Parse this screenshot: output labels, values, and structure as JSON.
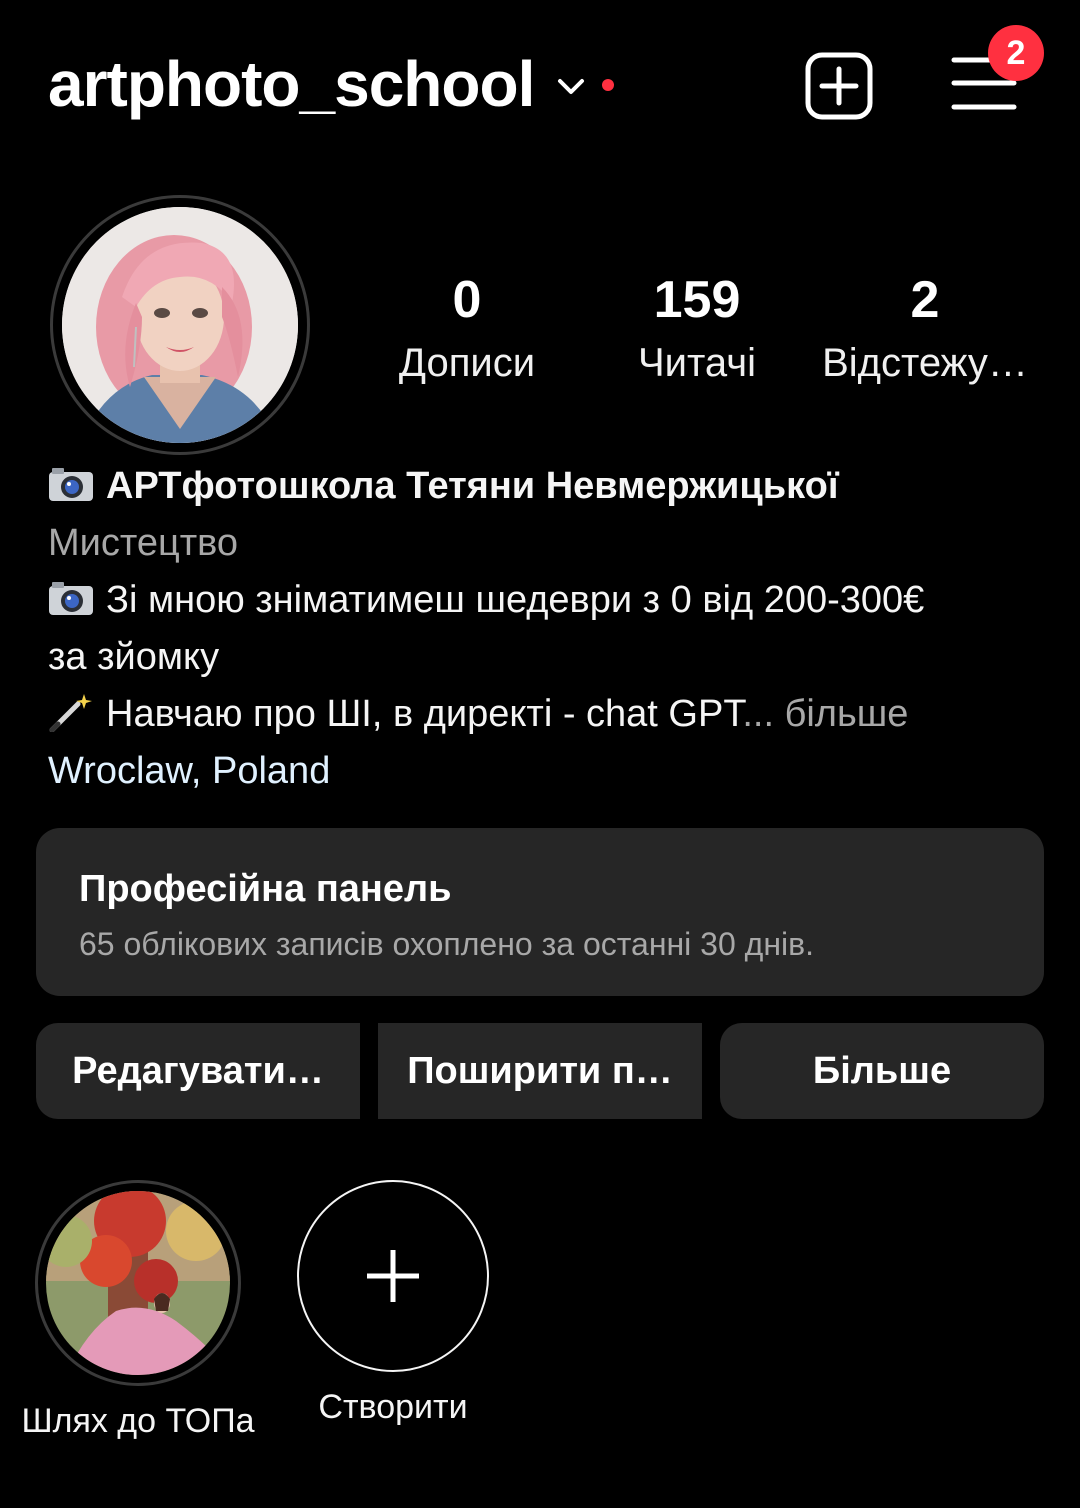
{
  "header": {
    "username": "artphoto_school",
    "notification_count": "2",
    "icons": {
      "switch_account": "chevron-down-icon",
      "create": "plus-square-icon",
      "menu": "hamburger-menu-icon"
    },
    "colors": {
      "badge": "#ff3040",
      "background": "#000000"
    }
  },
  "profile": {
    "stats": [
      {
        "value": "0",
        "label": "Дописи"
      },
      {
        "value": "159",
        "label": "Читачі"
      },
      {
        "value": "2",
        "label": "Відстежу…"
      }
    ],
    "display_name": "АРТфотошкола Тетяни Невмержицької",
    "category": "Мистецтво",
    "bio_line_1": "Зі мною зніматимеш шедеври з 0 від 200-300€",
    "bio_line_2": "за зйомку",
    "bio_line_3": "Навчаю про ШІ, в директі - chat GPT",
    "bio_ellipsis": "...",
    "more_label": "більше",
    "location": "Wroclaw, Poland",
    "icons": {
      "camera": "camera-emoji-icon",
      "wand": "magic-wand-emoji-icon"
    }
  },
  "professional_panel": {
    "title": "Професійна панель",
    "subtitle": "65 облікових записів охоплено за останні 30 днів."
  },
  "actions": {
    "edit_label": "Редагувати…",
    "share_label": "Поширити п…",
    "more_label": "Більше"
  },
  "highlights": [
    {
      "label": "Шлях до ТОПа"
    },
    {
      "label": "Створити",
      "icon": "plus-icon"
    }
  ]
}
